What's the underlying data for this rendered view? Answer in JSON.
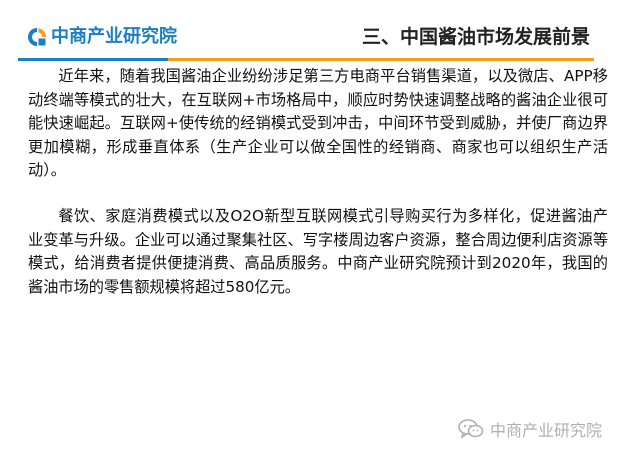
{
  "header": {
    "logo_text": "中商产业研究院",
    "title": "三、中国酱油市场发展前景"
  },
  "content": {
    "paragraphs": [
      "近年来，随着我国酱油企业纷纷涉足第三方电商平台销售渠道，以及微店、APP移动终端等模式的壮大，在互联网+市场格局中，顺应时势快速调整战略的酱油企业很可能快速崛起。互联网+使传统的经销模式受到冲击，中间环节受到威胁，并使厂商边界更加模糊，形成垂直体系（生产企业可以做全国性的经销商、商家也可以组织生产活动）。",
      "餐饮、家庭消费模式以及O2O新型互联网模式引导购买行为多样化，促进酱油产业变革与升级。企业可以通过聚集社区、写字楼周边客户资源，整合周边便利店资源等模式，给消费者提供便捷消费、高品质服务。中商产业研究院预计到2020年，我国的酱油市场的零售额规模将超过580亿元。"
    ]
  },
  "watermark": {
    "text": "中商产业研究院",
    "icon": "wechat-icon"
  },
  "colors": {
    "brand_blue": "#1a7fc4",
    "accent_orange": "#f39c1f",
    "watermark_gray": "#b0b0b0"
  }
}
